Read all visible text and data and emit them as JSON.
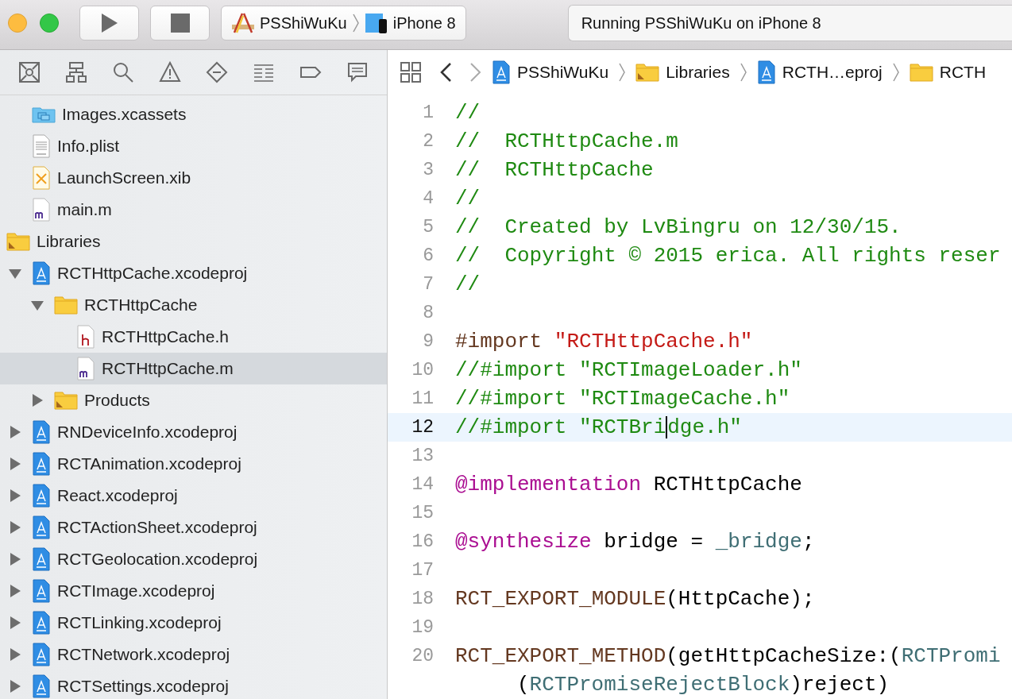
{
  "toolbar": {
    "scheme": {
      "project": "PSShiWuKu",
      "device": "iPhone 8"
    },
    "activity": "Running PSShiWuKu on iPhone 8"
  },
  "navigator": {
    "tabs": [
      {
        "kind": "project",
        "selected": false
      },
      {
        "kind": "symbols",
        "selected": false
      },
      {
        "kind": "find",
        "selected": false
      },
      {
        "kind": "issues",
        "selected": false
      },
      {
        "kind": "tests",
        "selected": false
      },
      {
        "kind": "debug",
        "selected": false
      },
      {
        "kind": "breakpoints",
        "selected": false
      },
      {
        "kind": "reports",
        "selected": false
      }
    ],
    "tree": [
      {
        "children": [
          {
            "label": "Images.xcassets",
            "kind": "xcassets",
            "selected": false
          },
          {
            "label": "Info.plist",
            "kind": "plist",
            "selected": false
          },
          {
            "label": "LaunchScreen.xib",
            "kind": "xib",
            "selected": false
          },
          {
            "label": "main.m",
            "kind": "m",
            "selected": false
          }
        ]
      },
      {
        "label": "Libraries",
        "kind": "group",
        "selected": false,
        "children": [
          {
            "label": "RCTHttpCache.xcodeproj",
            "kind": "xcodeproj",
            "selected": false,
            "expanded": true,
            "children": [
              {
                "label": "RCTHttpCache",
                "kind": "folder",
                "selected": false,
                "expanded": true,
                "children": [
                  {
                    "label": "RCTHttpCache.h",
                    "kind": "h",
                    "selected": false
                  },
                  {
                    "label": "RCTHttpCache.m",
                    "kind": "m",
                    "selected": true
                  }
                ]
              },
              {
                "label": "Products",
                "kind": "group",
                "selected": false,
                "expanded": false
              }
            ]
          },
          {
            "label": "RNDeviceInfo.xcodeproj",
            "kind": "xcodeproj",
            "selected": false,
            "expanded": false
          },
          {
            "label": "RCTAnimation.xcodeproj",
            "kind": "xcodeproj",
            "selected": false,
            "expanded": false
          },
          {
            "label": "React.xcodeproj",
            "kind": "xcodeproj",
            "selected": false,
            "expanded": false
          },
          {
            "label": "RCTActionSheet.xcodeproj",
            "kind": "xcodeproj",
            "selected": false,
            "expanded": false
          },
          {
            "label": "RCTGeolocation.xcodeproj",
            "kind": "xcodeproj",
            "selected": false,
            "expanded": false
          },
          {
            "label": "RCTImage.xcodeproj",
            "kind": "xcodeproj",
            "selected": false,
            "expanded": false
          },
          {
            "label": "RCTLinking.xcodeproj",
            "kind": "xcodeproj",
            "selected": false,
            "expanded": false
          },
          {
            "label": "RCTNetwork.xcodeproj",
            "kind": "xcodeproj",
            "selected": false,
            "expanded": false
          },
          {
            "label": "RCTSettings.xcodeproj",
            "kind": "xcodeproj",
            "selected": false,
            "expanded": false
          }
        ]
      }
    ]
  },
  "editor": {
    "jump_bar": [
      {
        "label": "PSShiWuKu",
        "kind": "xcodeproj"
      },
      {
        "label": "Libraries",
        "kind": "group"
      },
      {
        "label": "RCTH…eproj",
        "kind": "xcodeproj"
      },
      {
        "label": "RCTH",
        "kind": "folder"
      }
    ],
    "lines": [
      {
        "number": "1",
        "current": false,
        "tokens": [
          {
            "t": "//",
            "kind": "comment"
          }
        ]
      },
      {
        "number": "2",
        "current": false,
        "tokens": [
          {
            "t": "//  RCTHttpCache.m",
            "kind": "comment"
          }
        ]
      },
      {
        "number": "3",
        "current": false,
        "tokens": [
          {
            "t": "//  RCTHttpCache",
            "kind": "comment"
          }
        ]
      },
      {
        "number": "4",
        "current": false,
        "tokens": [
          {
            "t": "//",
            "kind": "comment"
          }
        ]
      },
      {
        "number": "5",
        "current": false,
        "tokens": [
          {
            "t": "//  Created by LvBingru on 12/30/15.",
            "kind": "comment"
          }
        ]
      },
      {
        "number": "6",
        "current": false,
        "tokens": [
          {
            "t": "//  Copyright © 2015 erica. All rights reser",
            "kind": "comment"
          }
        ]
      },
      {
        "number": "7",
        "current": false,
        "tokens": [
          {
            "t": "//",
            "kind": "comment"
          }
        ]
      },
      {
        "number": "8",
        "current": false
      },
      {
        "number": "9",
        "current": false,
        "tokens": [
          {
            "t": "#import",
            "kind": "directive"
          },
          {
            "t": "\"RCTHttpCache.h\"",
            "kind": "string"
          }
        ]
      },
      {
        "number": "10",
        "current": false,
        "tokens": [
          {
            "t": "//#import \"RCTImageLoader.h\"",
            "kind": "comment"
          }
        ]
      },
      {
        "number": "11",
        "current": false,
        "tokens": [
          {
            "t": "//#import \"RCTImageCache.h\"",
            "kind": "comment"
          }
        ]
      },
      {
        "number": "12",
        "current": true,
        "tokens": [
          {
            "t": "//#import \"RCTBri",
            "kind": "comment",
            "caret": true
          },
          {
            "t": "dge.h\"",
            "kind": "comment"
          }
        ]
      },
      {
        "number": "13",
        "current": false
      },
      {
        "number": "14",
        "current": false,
        "tokens": [
          {
            "t": "@implementation",
            "kind": "keyword"
          },
          {
            "t": "RCTHttpCache",
            "kind": "plain"
          }
        ]
      },
      {
        "number": "15",
        "current": false
      },
      {
        "number": "16",
        "current": false,
        "tokens": [
          {
            "t": "@synthesize",
            "kind": "keyword"
          },
          {
            "t": "bridge =",
            "kind": "plain"
          },
          {
            "t": "_bridge",
            "kind": "type"
          },
          {
            "t": ";",
            "kind": "plain"
          }
        ]
      },
      {
        "number": "17",
        "current": false
      },
      {
        "number": "18",
        "current": false,
        "tokens": [
          {
            "t": "RCT_EXPORT_MODULE",
            "kind": "macro"
          },
          {
            "t": "(HttpCache);",
            "kind": "plain"
          }
        ]
      },
      {
        "number": "19",
        "current": false
      },
      {
        "number": "20",
        "current": false,
        "tokens": [
          {
            "t": "RCT_EXPORT_METHOD",
            "kind": "macro"
          },
          {
            "t": "(getHttpCacheSize:(",
            "kind": "plain"
          },
          {
            "t": "RCTPromi",
            "kind": "type"
          }
        ],
        "continuation": [
          {
            "t": "(",
            "kind": "plain"
          },
          {
            "t": "RCTPromiseRejectBlock",
            "kind": "type"
          },
          {
            "t": ")reject)",
            "kind": "plain"
          }
        ]
      }
    ]
  }
}
